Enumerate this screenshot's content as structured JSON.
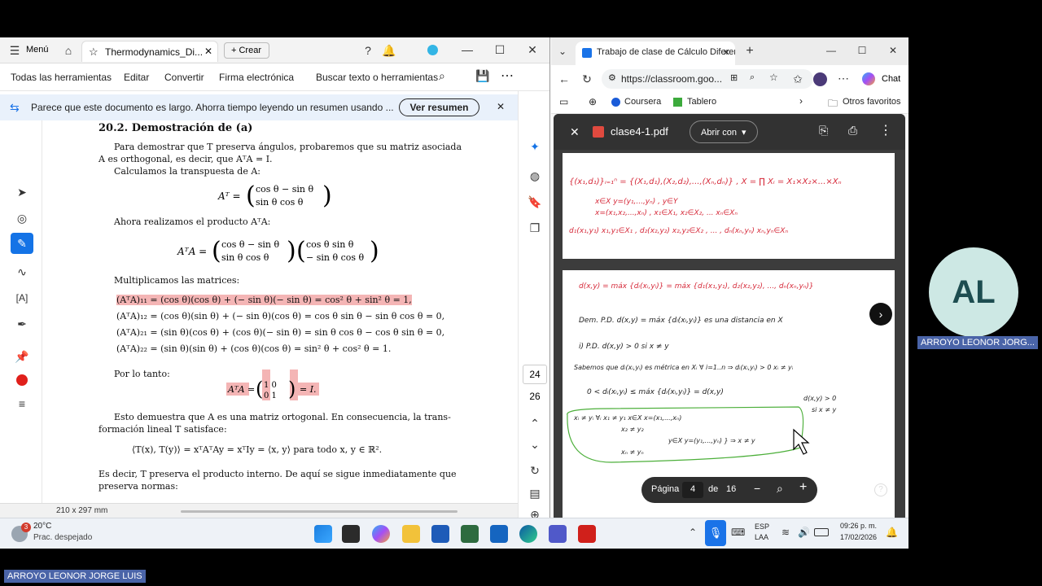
{
  "acrobat": {
    "menu_label": "Menú",
    "tab_title": "Thermodynamics_Di...",
    "create_label": "Crear",
    "toolbar": [
      "Todas las herramientas",
      "Editar",
      "Convertir",
      "Firma electrónica",
      "Buscar texto o herramientas"
    ],
    "banner_text": "Parece que este documento es largo. Ahorra tiempo leyendo un resumen usando ...",
    "banner_button": "Ver resumen",
    "page_size": "210 x 297 mm",
    "page_numbers": [
      "24",
      "26"
    ],
    "doc": {
      "heading": "20.2.   Demostración de (a)",
      "p1a": "Para demostrar que T preserva ángulos, probaremos que su matriz asociada",
      "p1b": "A es orthogonal, es decir, que AᵀA = I.",
      "p2": "Calculamos la transpuesta de A:",
      "p3": "Ahora realizamos el producto AᵀA:",
      "p4": "Multiplicamos las matrices:",
      "eq1": "(AᵀA)₁₁ = (cos θ)(cos θ) + (− sin θ)(− sin θ) = cos² θ + sin² θ = 1,",
      "eq2": "(AᵀA)₁₂ = (cos θ)(sin θ) + (− sin θ)(cos θ) = cos θ sin θ − sin θ cos θ = 0,",
      "eq3": "(AᵀA)₂₁ = (sin θ)(cos θ) + (cos θ)(− sin θ) = sin θ cos θ − cos θ sin θ = 0,",
      "eq4": "(AᵀA)₂₂ = (sin θ)(sin θ) + (cos θ)(cos θ) = sin² θ + cos² θ = 1.",
      "p5": "Por lo tanto:",
      "p6a": "Esto demuestra que A es una matriz ortogonal. En consecuencia, la trans-",
      "p6b": "formación lineal T satisface:",
      "eq5": "⟨T(x), T(y)⟩ = xᵀAᵀAy = xᵀIy = ⟨x, y⟩    para todo x, y ∈ ℝ².",
      "p7a": "Es decir, T preserva el producto interno. De aquí se sigue inmediatamente que",
      "p7b": "preserva normas:"
    }
  },
  "browser": {
    "tab_title": "Trabajo de clase de Cálculo Diferen",
    "url": "https://classroom.goo...",
    "chat_label": "Chat",
    "bookmarks": [
      "Coursera",
      "Tablero",
      "Otros favoritos"
    ],
    "file_name": "clase4-1.pdf",
    "open_with": "Abrir con",
    "pager": {
      "label": "Página",
      "current": "4",
      "of": "de",
      "total": "16"
    }
  },
  "taskbar": {
    "temp": "20°C",
    "weather": "Prac. despejado",
    "badge": "3",
    "lang1": "ESP",
    "lang2": "LAA",
    "time": "09:26 p. m.",
    "date": "17/02/2026"
  },
  "participant": {
    "initials": "AL",
    "name_short": "ARROYO LEONOR JORG...",
    "name_full": "ARROYO LEONOR JORGE LUIS"
  },
  "colors": {
    "accent": "#1a73e8",
    "ink_red": "#d62a3a",
    "highlight": "#f4b5b5"
  }
}
